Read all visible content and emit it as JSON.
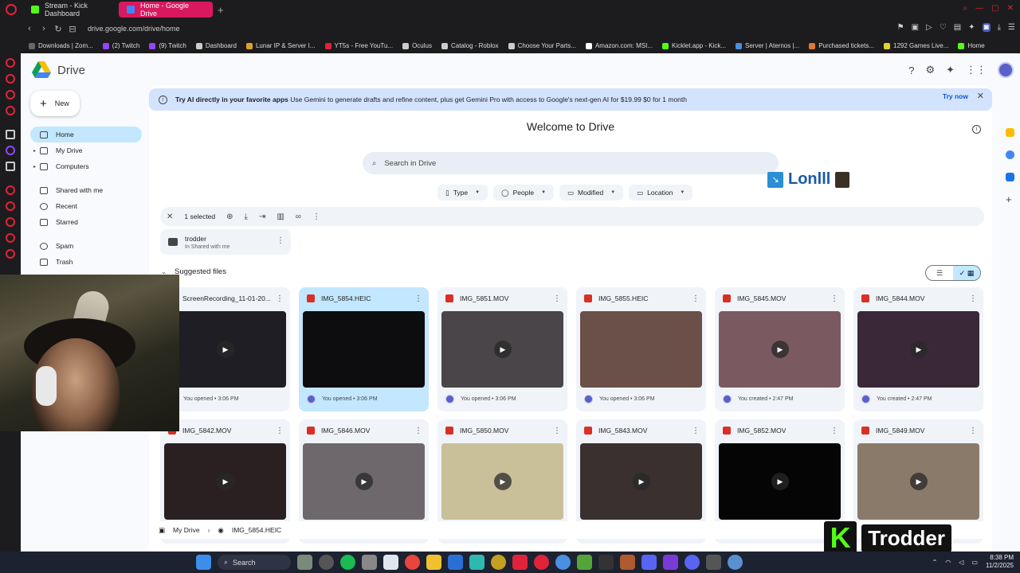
{
  "browser": {
    "tabs": [
      {
        "label": "Stream - Kick Dashboard",
        "active": false,
        "color": "#53fc18"
      },
      {
        "label": "Home - Google Drive",
        "active": true,
        "color": "#4285f4"
      }
    ],
    "url": "drive.google.com/drive/home",
    "bookmarks": [
      {
        "label": "Downloads | Zom...",
        "color": "#666666"
      },
      {
        "label": "(2) Twitch",
        "color": "#9146ff"
      },
      {
        "label": "(9) Twitch",
        "color": "#9146ff"
      },
      {
        "label": "Dashboard",
        "color": "#cccccc"
      },
      {
        "label": "Lunar IP & Server I...",
        "color": "#e0a030"
      },
      {
        "label": "YT5s - Free YouTu...",
        "color": "#e0233a"
      },
      {
        "label": "Oculus",
        "color": "#cccccc"
      },
      {
        "label": "Catalog - Roblox",
        "color": "#cccccc"
      },
      {
        "label": "Choose Your Parts...",
        "color": "#cccccc"
      },
      {
        "label": "Amazon.com: MSI...",
        "color": "#ffffff"
      },
      {
        "label": "Kicklet.app - Kick...",
        "color": "#53fc18"
      },
      {
        "label": "Server | Aternos |...",
        "color": "#4a8fe0"
      },
      {
        "label": "Purchased tickets...",
        "color": "#e07a30"
      },
      {
        "label": "1292 Games Live...",
        "color": "#e0d030"
      },
      {
        "label": "Home",
        "color": "#53fc18"
      }
    ]
  },
  "drive": {
    "app_name": "Drive",
    "new_label": "New",
    "nav": [
      {
        "label": "Home",
        "icon": "home-icon",
        "selected": true
      },
      {
        "label": "My Drive",
        "icon": "my-drive-icon",
        "selected": false,
        "caret": true
      },
      {
        "label": "Computers",
        "icon": "computer-icon",
        "selected": false,
        "caret": true
      },
      {
        "label": "Shared with me",
        "icon": "shared-icon",
        "selected": false
      },
      {
        "label": "Recent",
        "icon": "clock-icon",
        "selected": false
      },
      {
        "label": "Starred",
        "icon": "star-icon",
        "selected": false
      },
      {
        "label": "Spam",
        "icon": "spam-icon",
        "selected": false
      },
      {
        "label": "Trash",
        "icon": "trash-icon",
        "selected": false
      }
    ],
    "banner": {
      "bold": "Try AI directly in your favorite apps",
      "text": "Use Gemini to generate drafts and refine content, plus get Gemini Pro with access to Google's next-gen AI for $19.99 $0 for 1 month",
      "cta": "Try now"
    },
    "welcome": "Welcome to Drive",
    "search_placeholder": "Search in Drive",
    "filters": [
      "Type",
      "People",
      "Modified",
      "Location"
    ],
    "selection": {
      "count_label": "1 selected"
    },
    "folder": {
      "name": "trodder",
      "location": "In Shared with me"
    },
    "suggested_title": "Suggested files",
    "files": [
      {
        "name": "ScreenRecording_11-01-20...",
        "activity": "You opened • 3:06 PM",
        "selected": false,
        "video": true,
        "thumb": "#1e1e24"
      },
      {
        "name": "IMG_5854.HEIC",
        "activity": "You opened • 3:06 PM",
        "selected": true,
        "video": false,
        "thumb": "#0d0d10"
      },
      {
        "name": "IMG_5851.MOV",
        "activity": "You opened • 3:06 PM",
        "selected": false,
        "video": true,
        "thumb": "#4a4548"
      },
      {
        "name": "IMG_5855.HEIC",
        "activity": "You opened • 3:06 PM",
        "selected": false,
        "video": false,
        "thumb": "#6a5048"
      },
      {
        "name": "IMG_5845.MOV",
        "activity": "You created • 2:47 PM",
        "selected": false,
        "video": true,
        "thumb": "#7a5a60"
      },
      {
        "name": "IMG_5844.MOV",
        "activity": "You created • 2:47 PM",
        "selected": false,
        "video": true,
        "thumb": "#3a2838"
      },
      {
        "name": "IMG_5842.MOV",
        "activity": "",
        "selected": false,
        "video": true,
        "thumb": "#2a2022"
      },
      {
        "name": "IMG_5846.MOV",
        "activity": "",
        "selected": false,
        "video": true,
        "thumb": "#6e686c"
      },
      {
        "name": "IMG_5850.MOV",
        "activity": "",
        "selected": false,
        "video": true,
        "thumb": "#c9c09a"
      },
      {
        "name": "IMG_5843.MOV",
        "activity": "",
        "selected": false,
        "video": true,
        "thumb": "#3a3030"
      },
      {
        "name": "IMG_5852.MOV",
        "activity": "",
        "selected": false,
        "video": true,
        "thumb": "#050505"
      },
      {
        "name": "IMG_5849.MOV",
        "activity": "",
        "selected": false,
        "video": true,
        "thumb": "#8a7a6a"
      }
    ],
    "breadcrumb": [
      "My Drive",
      "IMG_5854.HEIC"
    ]
  },
  "overlays": {
    "lonlll": "Lonlll",
    "kick_brand": "Trodder"
  },
  "taskbar": {
    "search_label": "Search",
    "time": "8:38 PM",
    "date": "11/2/2025"
  }
}
